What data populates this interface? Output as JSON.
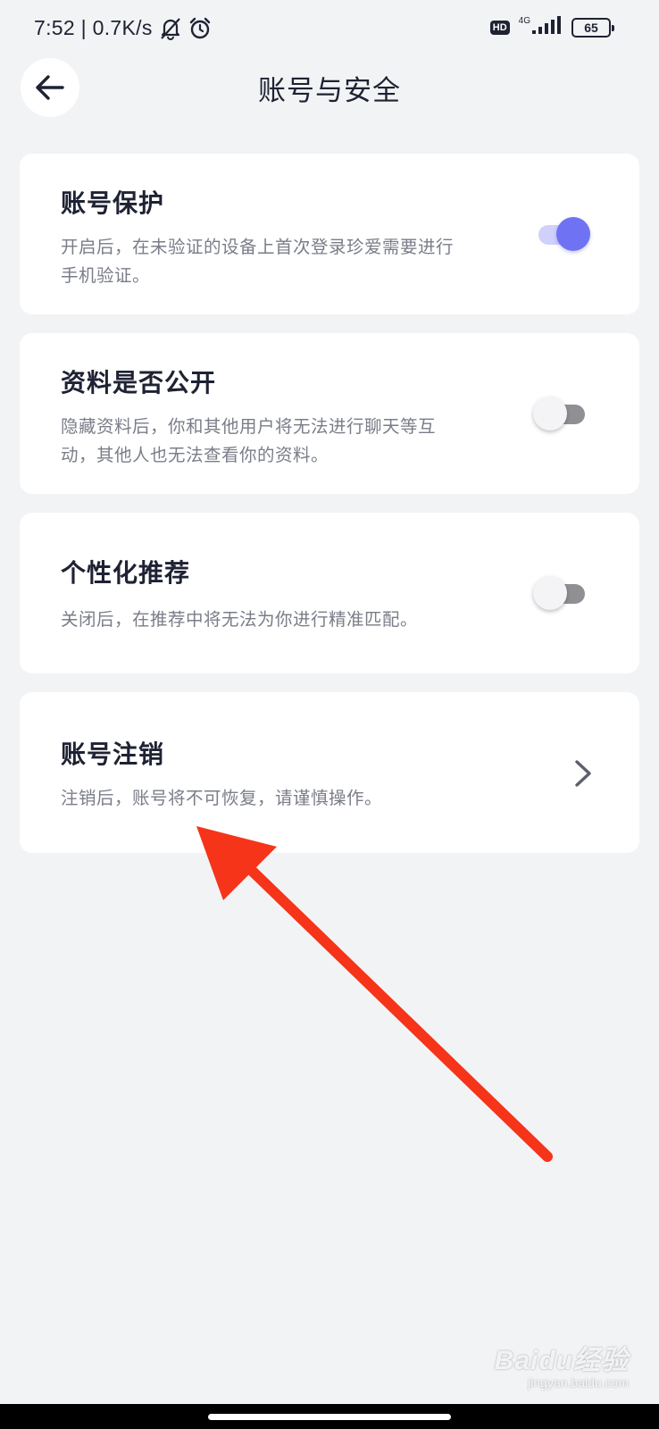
{
  "status_bar": {
    "time_speed": "7:52 | 0.7K/s",
    "network": "4G",
    "hd": "HD",
    "battery": "65"
  },
  "header": {
    "title": "账号与安全"
  },
  "settings": [
    {
      "title": "账号保护",
      "desc_line1": "开启后，在未验证的设备上首次登录珍爱需要进行",
      "desc_line2": "手机验证。",
      "toggle": "on"
    },
    {
      "title": "资料是否公开",
      "desc_line1": "隐藏资料后，你和其他用户将无法进行聊天等互",
      "desc_line2": "动，其他人也无法查看你的资料。",
      "toggle": "off"
    },
    {
      "title": "个性化推荐",
      "desc_line1": "关闭后，在推荐中将无法为你进行精准匹配。",
      "toggle": "off"
    },
    {
      "title": "账号注销",
      "desc_line1": "注销后，账号将不可恢复，请谨慎操作。",
      "action": "chevron-right"
    }
  ],
  "annotation": {
    "color": "#f5341a"
  },
  "watermark": {
    "brand": "Baidu经验",
    "url": "jingyan.baidu.com"
  },
  "colors": {
    "background": "#f2f3f5",
    "accent": "#6f73f3",
    "card": "#ffffff"
  }
}
